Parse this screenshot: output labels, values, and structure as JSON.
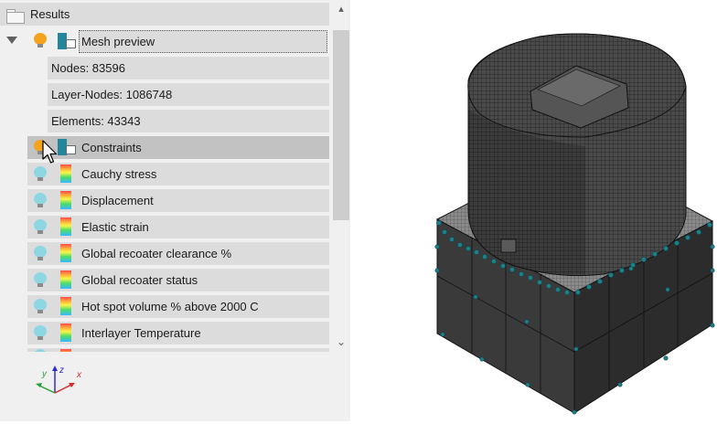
{
  "tree": {
    "root_label": "Results",
    "mesh_preview": {
      "label": "Mesh preview",
      "nodes": "Nodes: 83596",
      "layer_nodes": "Layer-Nodes: 1086748",
      "elements": "Elements: 43343"
    },
    "items": [
      {
        "label": "Constraints",
        "icon": "mesh-icon",
        "bulb": "on"
      },
      {
        "label": "Cauchy stress",
        "icon": "gradient-icon",
        "bulb": "off"
      },
      {
        "label": "Displacement",
        "icon": "gradient-icon",
        "bulb": "off"
      },
      {
        "label": "Elastic strain",
        "icon": "gradient-icon",
        "bulb": "off"
      },
      {
        "label": "Global recoater clearance %",
        "icon": "gradient-icon",
        "bulb": "off"
      },
      {
        "label": "Global recoater status",
        "icon": "gradient-icon",
        "bulb": "off"
      },
      {
        "label": "Hot spot volume % above 2000 C",
        "icon": "gradient-icon",
        "bulb": "off"
      },
      {
        "label": "Interlayer Temperature",
        "icon": "gradient-icon",
        "bulb": "off"
      }
    ]
  },
  "triad": {
    "x": "x",
    "y": "y",
    "z": "z"
  },
  "colors": {
    "accent_bulb": "#f5a21c",
    "off_bulb": "#8fd6e3",
    "mesh_icon": "#23869a",
    "constraint_marker": "#1c7f8a",
    "mesh_dark": "#3a3a3a"
  }
}
